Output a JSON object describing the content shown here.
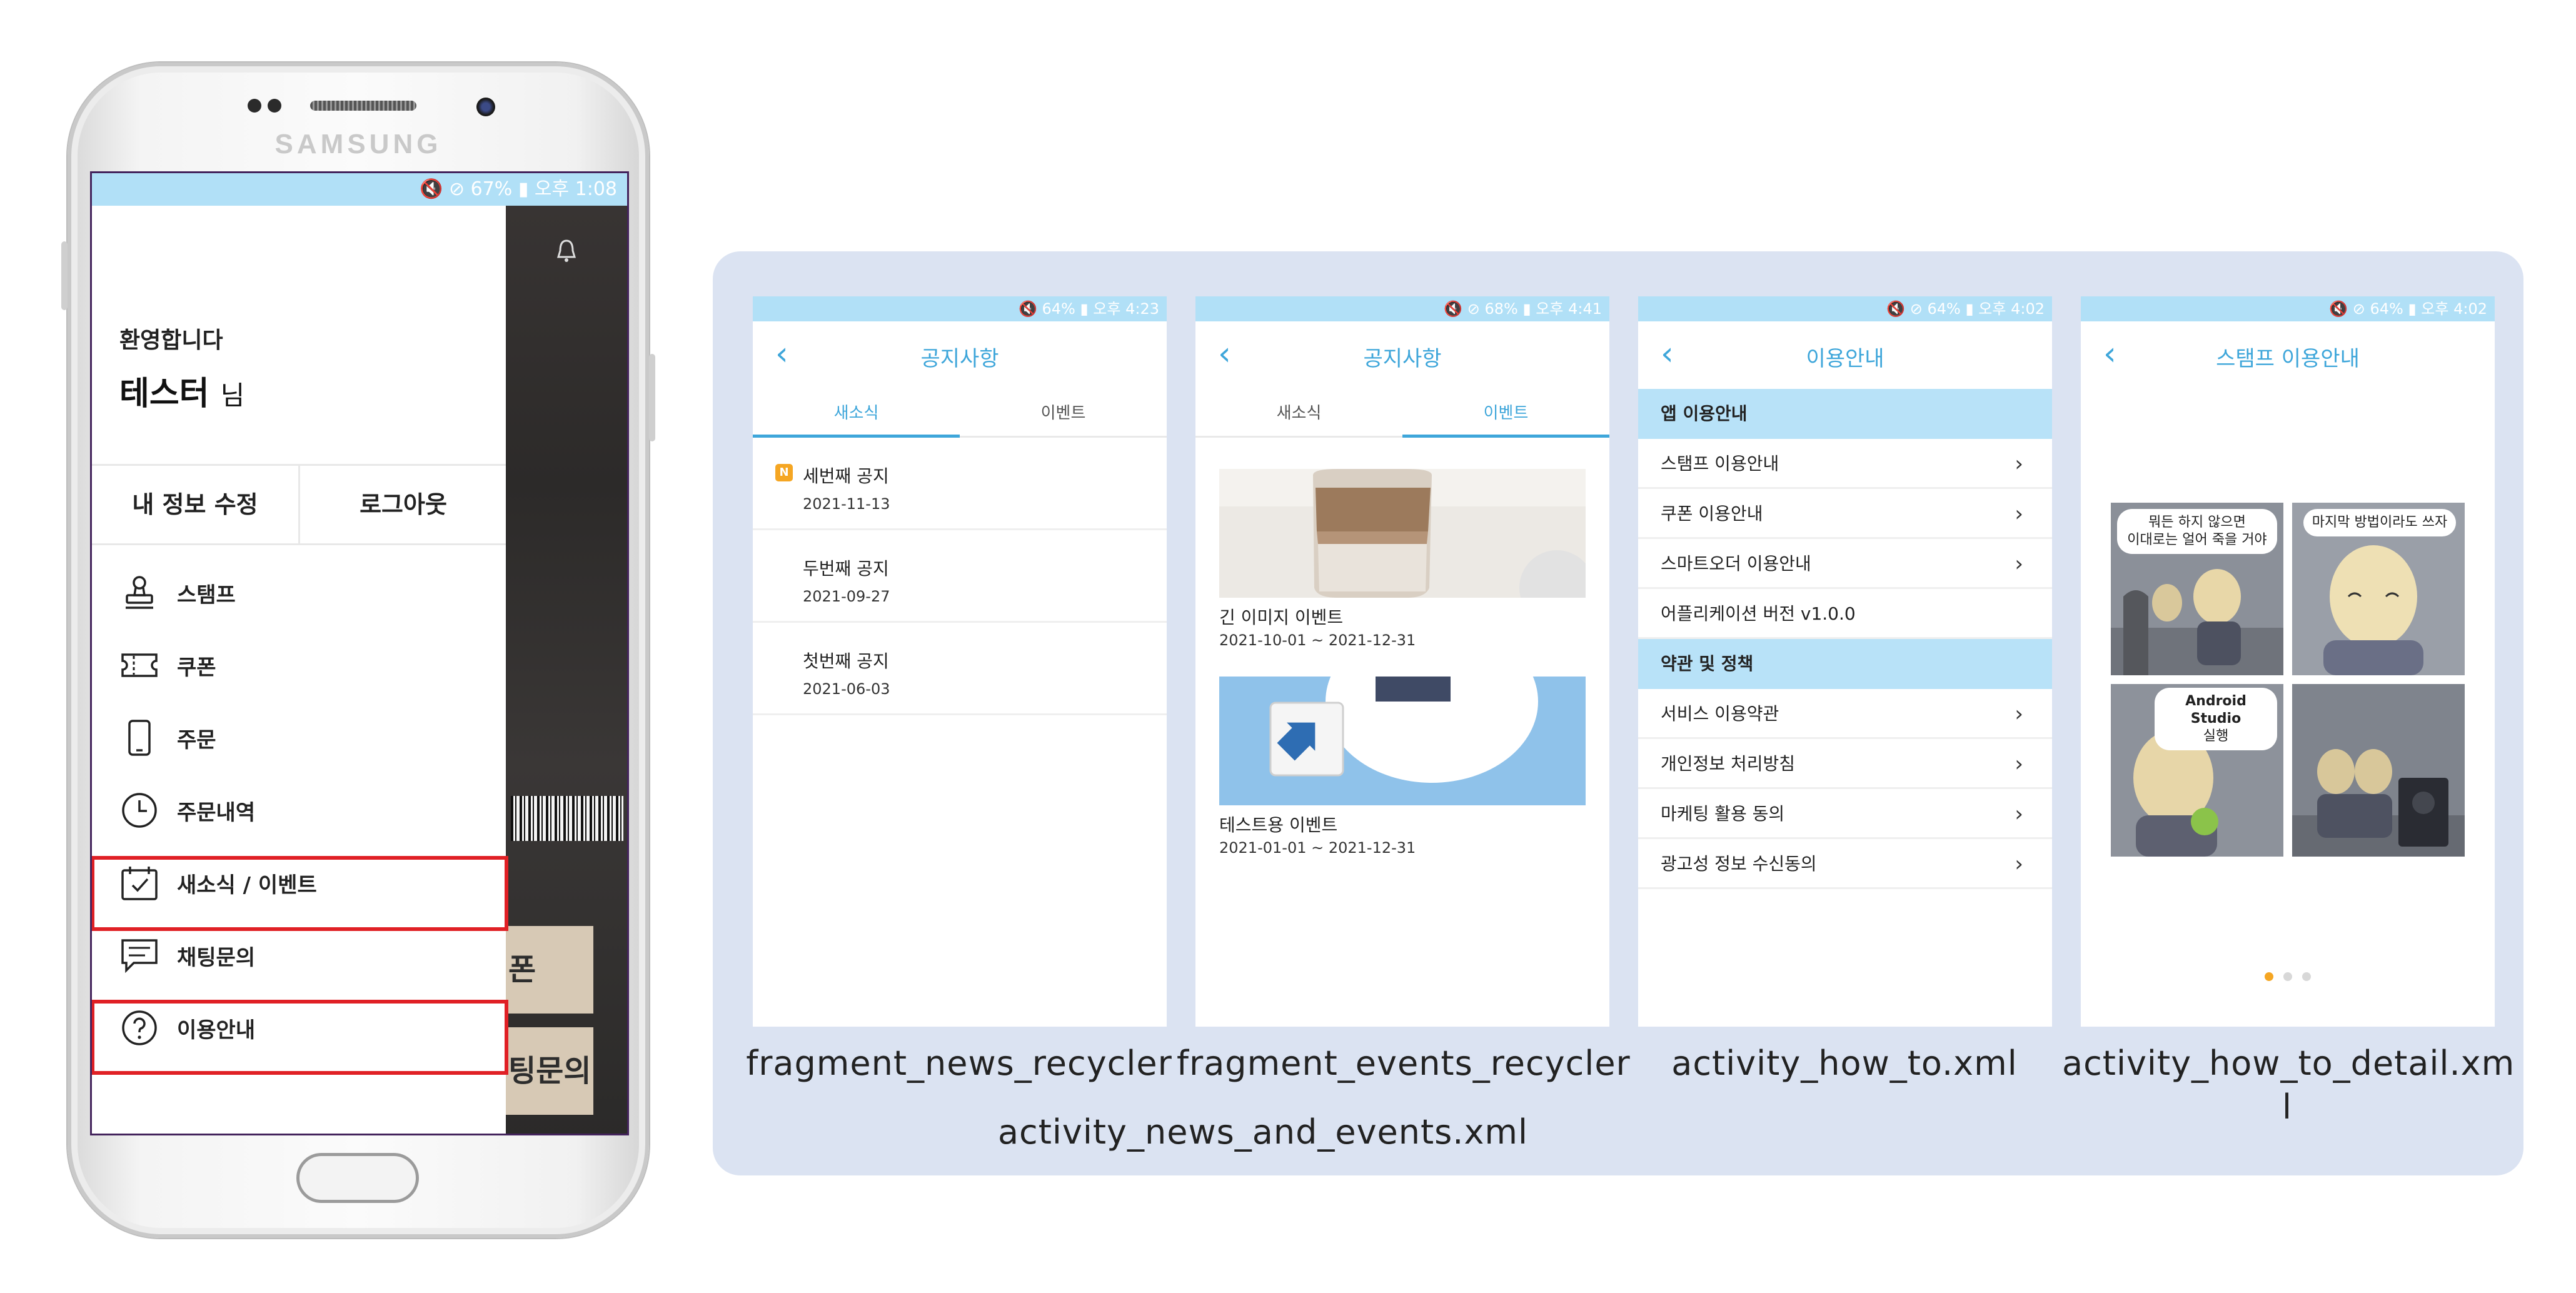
{
  "phone": {
    "brand": "SAMSUNG",
    "status": "🔇 ⊘ 67% ▮ 오후 1:08",
    "welcome": "환영합니다",
    "user_name": "테스터",
    "user_suffix": "님",
    "edit_profile": "내 정보 수정",
    "logout": "로그아웃",
    "menu": [
      {
        "label": "스탬프",
        "icon": "stamp-icon"
      },
      {
        "label": "쿠폰",
        "icon": "ticket-icon"
      },
      {
        "label": "주문",
        "icon": "phone-icon"
      },
      {
        "label": "주문내역",
        "icon": "clock-icon"
      },
      {
        "label": "새소식 / 이벤트",
        "icon": "calendar-check-icon"
      },
      {
        "label": "채팅문의",
        "icon": "chat-icon"
      },
      {
        "label": "이용안내",
        "icon": "help-icon"
      }
    ],
    "bg_text_1": "폰",
    "bg_text_2": "팅문의",
    "highlight_color": "#e02025"
  },
  "screens": {
    "news": {
      "status": "🔇 64% ▮ 오후 4:23",
      "title": "공지사항",
      "tabs": [
        "새소식",
        "이벤트"
      ],
      "items": [
        {
          "badge": "N",
          "title": "세번째 공지",
          "date": "2021-11-13"
        },
        {
          "badge": "",
          "title": "두번째 공지",
          "date": "2021-09-27"
        },
        {
          "badge": "",
          "title": "첫번째 공지",
          "date": "2021-06-03"
        }
      ],
      "caption": "fragment_news_recycler"
    },
    "events": {
      "status": "🔇 ⊘ 68% ▮ 오후 4:41",
      "title": "공지사항",
      "tabs": [
        "새소식",
        "이벤트"
      ],
      "items": [
        {
          "title": "긴 이미지 이벤트",
          "date": "2021-10-01 ~ 2021-12-31"
        },
        {
          "title": "테스트용 이벤트",
          "date": "2021-01-01 ~ 2021-12-31"
        }
      ],
      "caption": "fragment_events_recycler"
    },
    "howto": {
      "status": "🔇 ⊘ 64% ▮ 오후 4:02",
      "title": "이용안내",
      "section_app": "앱 이용안내",
      "app_rows": [
        "스탬프 이용안내",
        "쿠폰 이용안내",
        "스마트오더 이용안내",
        "어플리케이션 버전 v1.0.0"
      ],
      "section_terms": "약관 및 정책",
      "terms_rows": [
        "서비스 이용약관",
        "개인정보 처리방침",
        "마케팅 활용 동의",
        "광고성 정보 수신동의"
      ],
      "caption": "activity_how_to.xml"
    },
    "detail": {
      "status": "🔇 ⊘ 64% ▮ 오후 4:02",
      "title": "스탬프 이용안내",
      "bubble_1a": "뭐든 하지 않으면",
      "bubble_1b": "이대로는 얼어 죽을 거야",
      "bubble_2": "마지막 방법이라도 쓰자",
      "bubble_3a": "Android Studio",
      "bubble_3b": "실행",
      "caption_1": "activity_how_to_detail.xm",
      "caption_2": "l"
    }
  },
  "group_caption": "activity_news_and_events.xml",
  "colors": {
    "accent": "#3ea6da",
    "status_bar": "#b1e0f7",
    "panel_bg": "#dbe3f2",
    "badge": "#f5a623"
  }
}
